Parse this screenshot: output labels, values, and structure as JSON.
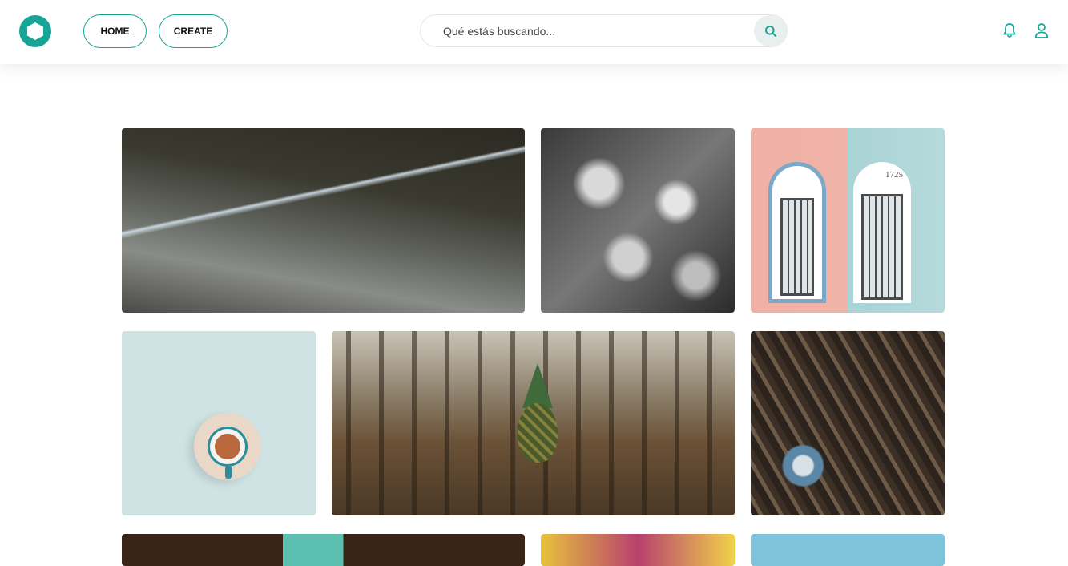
{
  "header": {
    "logo_icon": "hexagon-logo-icon",
    "nav": [
      {
        "label": "HOME"
      },
      {
        "label": "CREATE"
      }
    ],
    "search": {
      "placeholder": "Qué estás buscando...",
      "value": ""
    },
    "icons": {
      "search": "search-icon",
      "notifications": "bell-icon",
      "profile": "user-icon"
    }
  },
  "gallery": {
    "images": [
      {
        "subject": "tunnel-corridor"
      },
      {
        "subject": "aerial-landscape-bw"
      },
      {
        "subject": "doors-pink-blue",
        "visible_text": "1725"
      },
      {
        "subject": "coffee-cup"
      },
      {
        "subject": "pineapple-forest"
      },
      {
        "subject": "antique-clutter"
      },
      {
        "subject": "partial-dark"
      },
      {
        "subject": "partial-colorful"
      },
      {
        "subject": "partial-sky"
      }
    ]
  },
  "colors": {
    "accent": "#16a596",
    "search_btn_bg": "#e9eeee"
  }
}
